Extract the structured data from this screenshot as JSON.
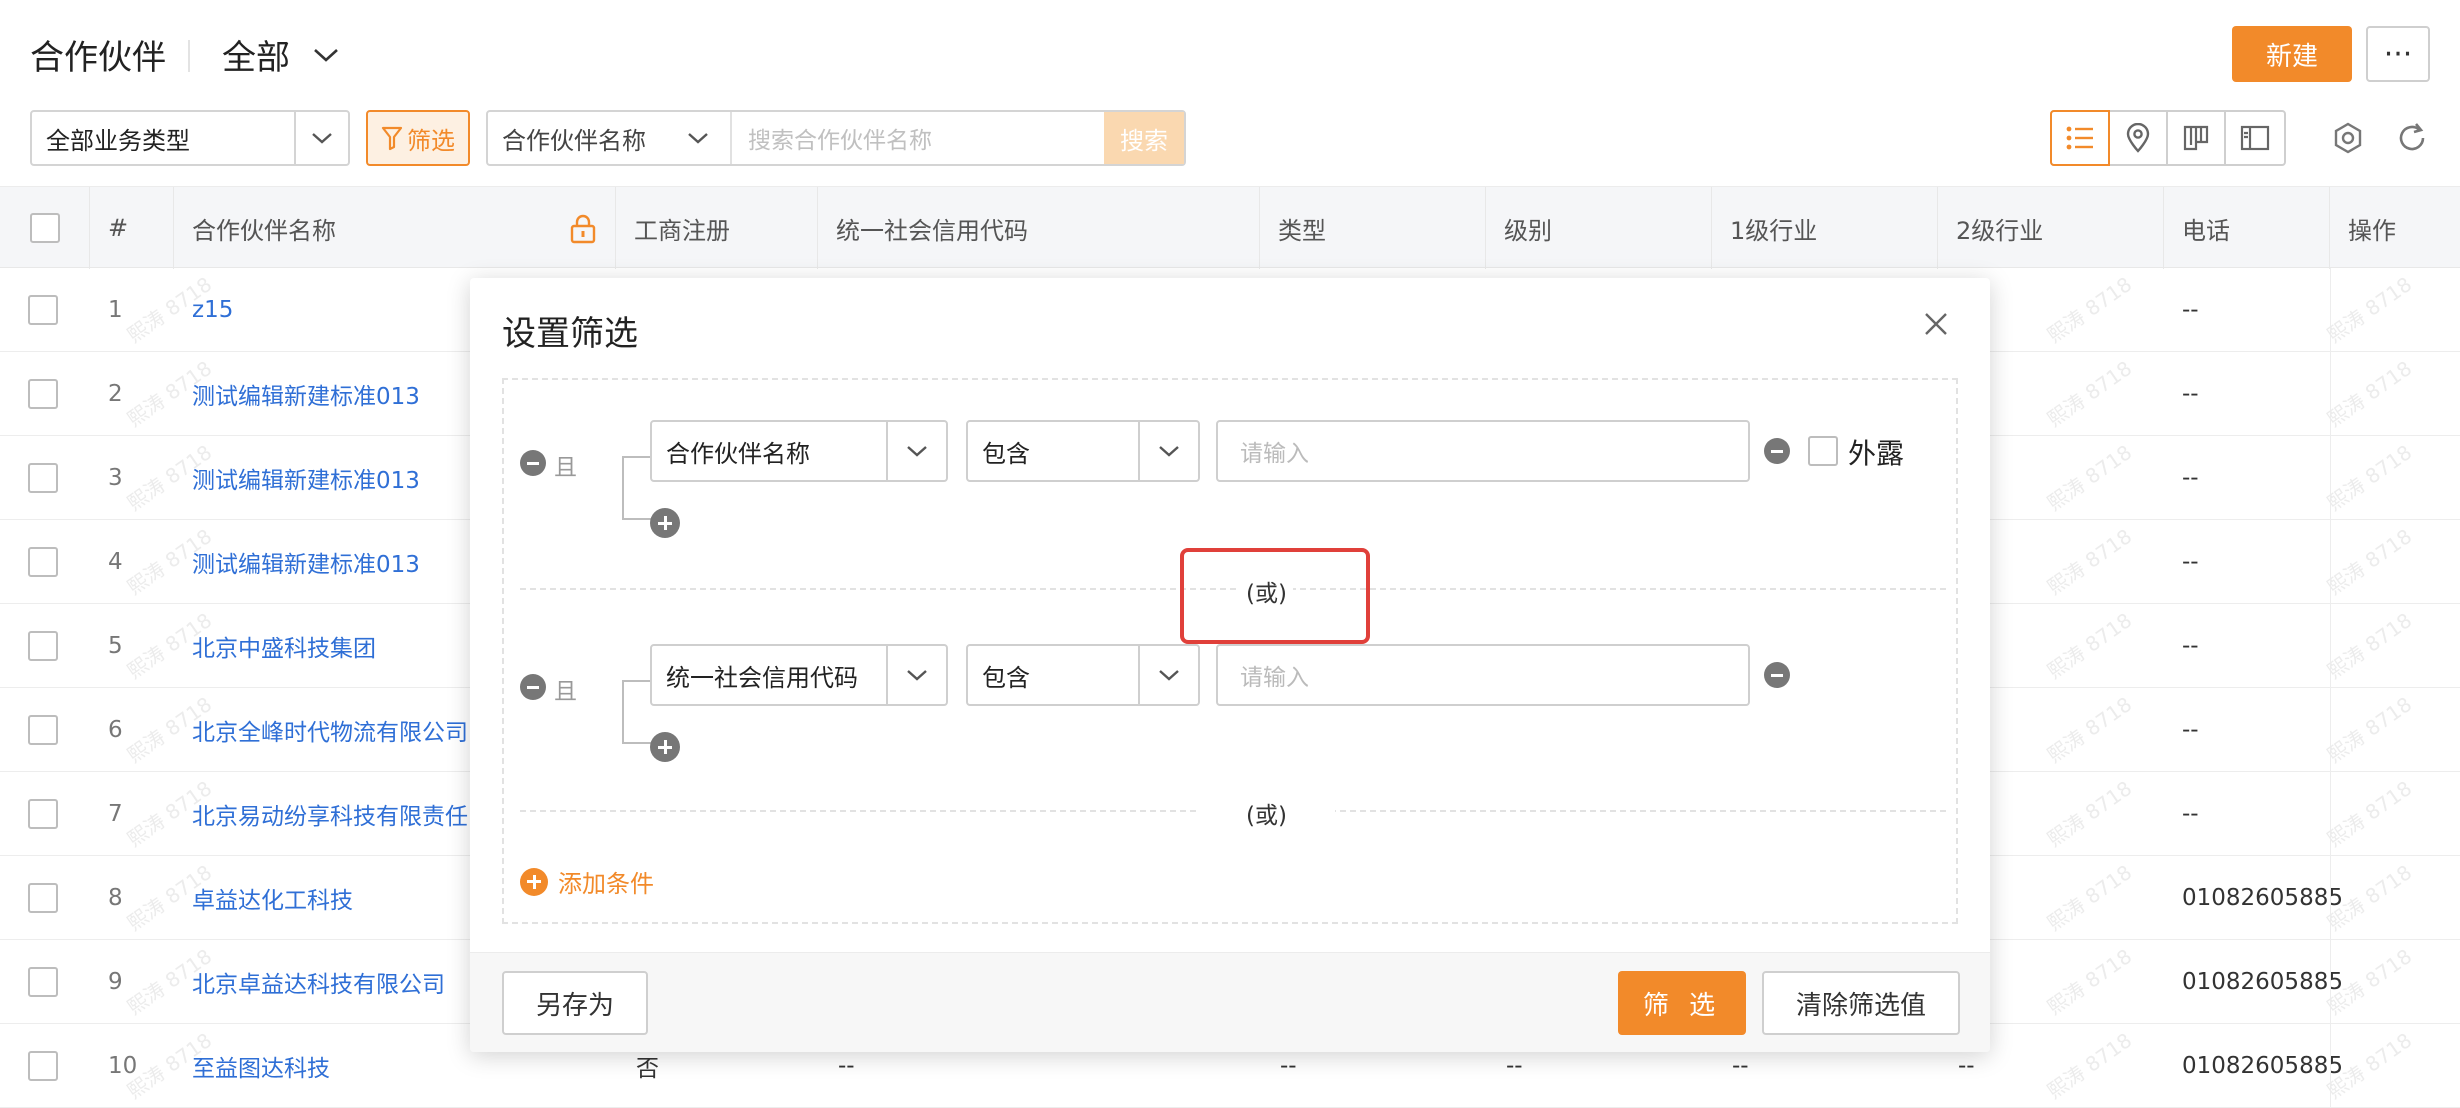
{
  "header": {
    "title": "合作伙伴",
    "view": "全部",
    "new_label": "新建",
    "more_label": "···"
  },
  "toolbar": {
    "biz_type": "全部业务类型",
    "filter_label": "筛选",
    "search_field": "合作伙伴名称",
    "search_placeholder": "搜索合作伙伴名称",
    "search_label": "搜索"
  },
  "table": {
    "columns": [
      "#",
      "合作伙伴名称",
      "工商注册",
      "统一社会信用代码",
      "类型",
      "级别",
      "1级行业",
      "2级行业",
      "电话",
      "操作"
    ],
    "rows": [
      {
        "idx": "1",
        "name": "z15",
        "phone": "--"
      },
      {
        "idx": "2",
        "name": "测试编辑新建标准013",
        "phone": "--"
      },
      {
        "idx": "3",
        "name": "测试编辑新建标准013",
        "phone": "--"
      },
      {
        "idx": "4",
        "name": "测试编辑新建标准013",
        "phone": "--"
      },
      {
        "idx": "5",
        "name": "北京中盛科技集团",
        "phone": "--"
      },
      {
        "idx": "6",
        "name": "北京全峰时代物流有限公司",
        "phone": "--"
      },
      {
        "idx": "7",
        "name": "北京易动纷享科技有限责任",
        "phone": "--"
      },
      {
        "idx": "8",
        "name": "卓益达化工科技",
        "phone": "01082605885"
      },
      {
        "idx": "9",
        "name": "北京卓益达科技有限公司",
        "phone": "01082605885"
      },
      {
        "idx": "10",
        "name": "至益图达科技",
        "reg": "否",
        "credit": "--",
        "type": "--",
        "level": "--",
        "ind1": "--",
        "ind2": "--",
        "phone": "01082605885"
      }
    ],
    "watermark": "熙涛 8718"
  },
  "modal": {
    "title": "设置筛选",
    "groups": [
      {
        "and_label": "且",
        "field": "合作伙伴名称",
        "operator": "包含",
        "placeholder": "请输入",
        "expose_label": "外露"
      },
      {
        "and_label": "且",
        "field": "统一社会信用代码",
        "operator": "包含",
        "placeholder": "请输入"
      }
    ],
    "or_label": "(或)",
    "add_condition": "添加条件",
    "save_as": "另存为",
    "apply": "筛 选",
    "clear": "清除筛选值"
  },
  "colors": {
    "accent": "#f28a2a",
    "link": "#2f6fd6",
    "highlight": "#e0403a"
  }
}
